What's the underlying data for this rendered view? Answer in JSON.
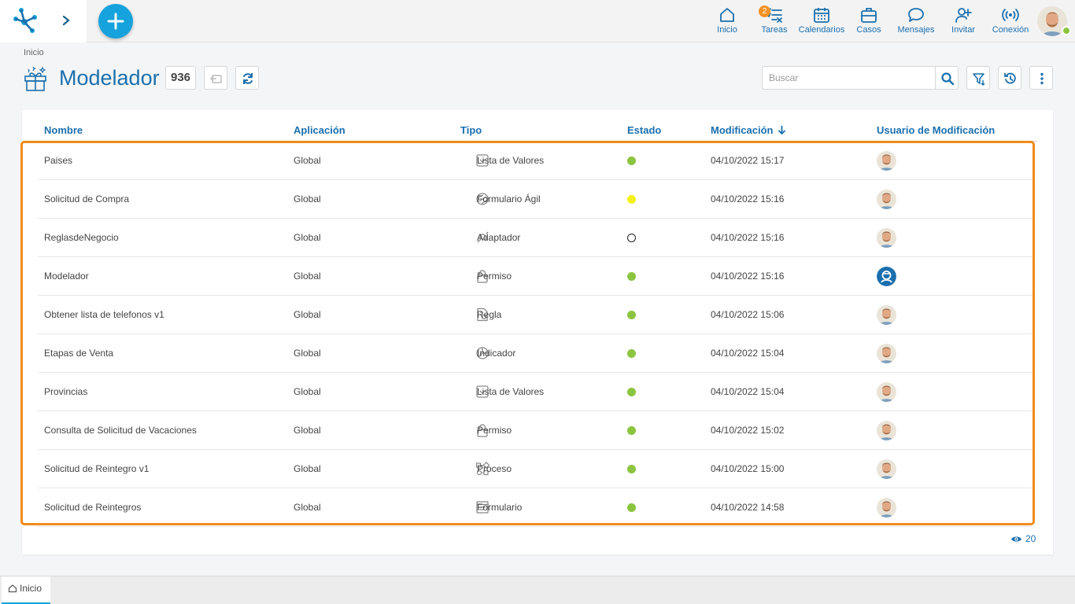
{
  "topnav": {
    "items": [
      {
        "label": "Inicio",
        "icon": "home-icon"
      },
      {
        "label": "Tareas",
        "icon": "tasks-icon",
        "badge": "2"
      },
      {
        "label": "Calendarios",
        "icon": "calendar-icon"
      },
      {
        "label": "Casos",
        "icon": "briefcase-icon"
      },
      {
        "label": "Mensajes",
        "icon": "chat-icon"
      },
      {
        "label": "Invitar",
        "icon": "invite-icon"
      },
      {
        "label": "Conexión",
        "icon": "connection-icon"
      }
    ]
  },
  "breadcrumb": "Inicio",
  "page": {
    "title": "Modelador",
    "count": "936"
  },
  "search": {
    "placeholder": "Buscar",
    "value": ""
  },
  "table": {
    "columns": {
      "nombre": "Nombre",
      "aplicacion": "Aplicación",
      "tipo": "Tipo",
      "estado": "Estado",
      "modificacion": "Modificación",
      "usuario": "Usuario de Modificación"
    },
    "rows": [
      {
        "nombre": "Paises",
        "aplicacion": "Global",
        "tipo": "Lista de Valores",
        "tipo_icon": "list-values-icon",
        "estado": "green",
        "modificacion": "04/10/2022 15:17",
        "usuario": "photo"
      },
      {
        "nombre": "Solicitud de Compra",
        "aplicacion": "Global",
        "tipo": "Formulario Ágil",
        "tipo_icon": "agile-form-icon",
        "estado": "yellow",
        "modificacion": "04/10/2022 15:16",
        "usuario": "photo"
      },
      {
        "nombre": "ReglasdeNegocio",
        "aplicacion": "Global",
        "tipo": "Adaptador",
        "tipo_icon": "adapter-icon",
        "estado": "empty",
        "modificacion": "04/10/2022 15:16",
        "usuario": "photo"
      },
      {
        "nombre": "Modelador",
        "aplicacion": "Global",
        "tipo": "Permiso",
        "tipo_icon": "lock-icon",
        "estado": "green",
        "modificacion": "04/10/2022 15:16",
        "usuario": "system"
      },
      {
        "nombre": "Obtener lista de telefonos v1",
        "aplicacion": "Global",
        "tipo": "Regla",
        "tipo_icon": "rule-icon",
        "estado": "green",
        "modificacion": "04/10/2022 15:06",
        "usuario": "photo"
      },
      {
        "nombre": "Etapas de Venta",
        "aplicacion": "Global",
        "tipo": "Indicador",
        "tipo_icon": "indicator-icon",
        "estado": "green",
        "modificacion": "04/10/2022 15:04",
        "usuario": "photo"
      },
      {
        "nombre": "Provincias",
        "aplicacion": "Global",
        "tipo": "Lista de Valores",
        "tipo_icon": "list-values-icon",
        "estado": "green",
        "modificacion": "04/10/2022 15:04",
        "usuario": "photo"
      },
      {
        "nombre": "Consulta de Solicitud de Vacaciones",
        "aplicacion": "Global",
        "tipo": "Permiso",
        "tipo_icon": "lock-icon",
        "estado": "green",
        "modificacion": "04/10/2022 15:02",
        "usuario": "photo"
      },
      {
        "nombre": "Solicitud de Reintegro v1",
        "aplicacion": "Global",
        "tipo": "Proceso",
        "tipo_icon": "process-icon",
        "estado": "green",
        "modificacion": "04/10/2022 15:00",
        "usuario": "photo"
      },
      {
        "nombre": "Solicitud de Reintegros",
        "aplicacion": "Global",
        "tipo": "Formulario",
        "tipo_icon": "form-icon",
        "estado": "green",
        "modificacion": "04/10/2022 14:58",
        "usuario": "photo"
      }
    ]
  },
  "footer": {
    "page_size": "20"
  },
  "bottom_tabs": [
    {
      "label": "Inicio"
    }
  ],
  "colors": {
    "accent": "#1b6fae",
    "fab": "#16a2dc",
    "highlight": "#f08c1a",
    "state_green": "#8bc540",
    "state_yellow": "#f5f017"
  }
}
